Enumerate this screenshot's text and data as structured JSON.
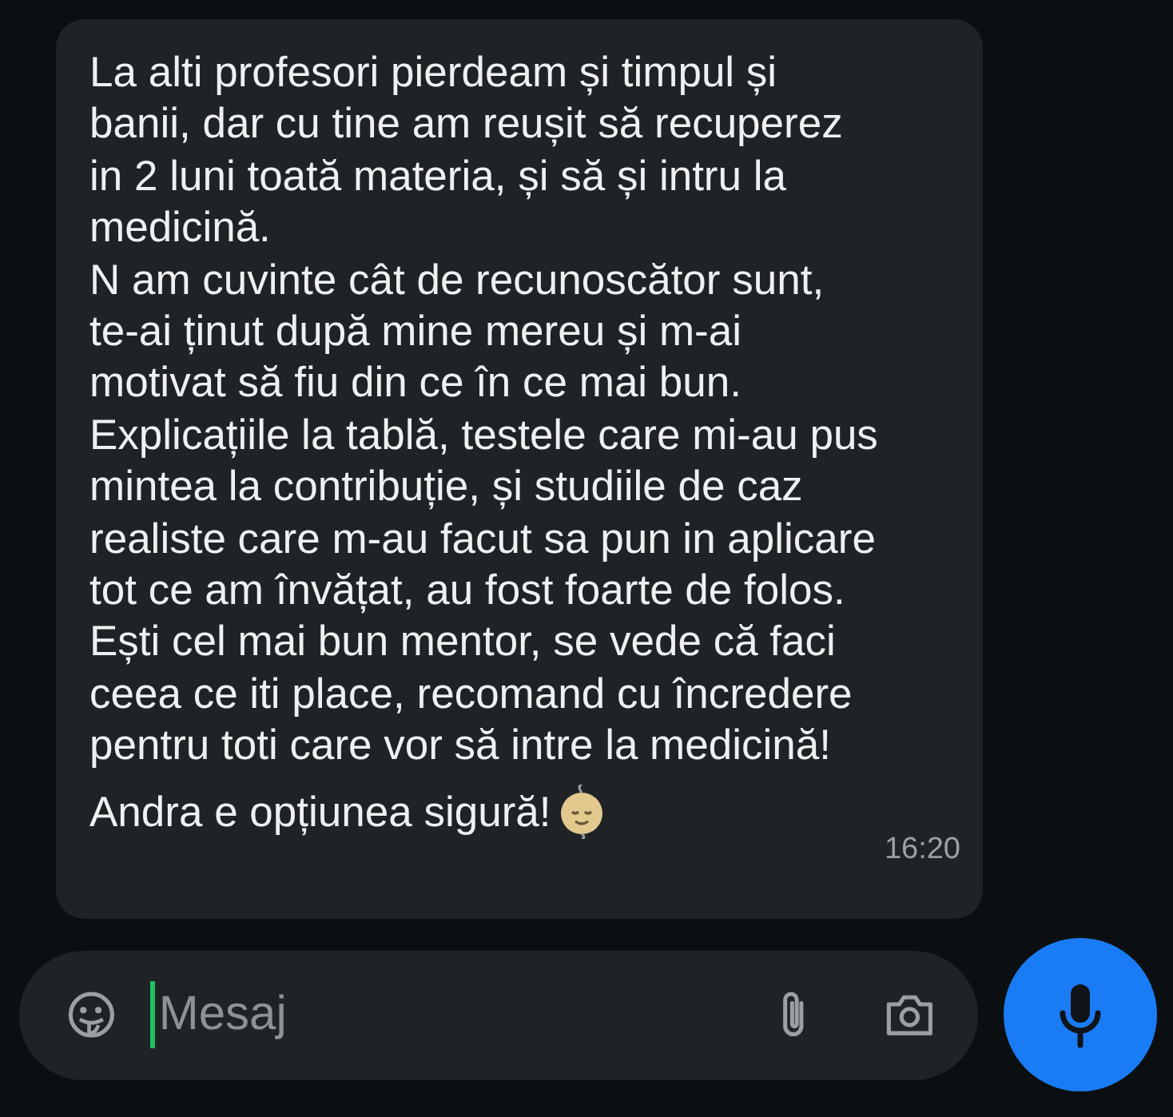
{
  "message": {
    "text": "La alti profesori pierdeam și timpul și\nbanii, dar cu tine am reușit să recuperez\nin 2 luni toată materia, și să și intru la\nmedicină.\nN am cuvinte cât de recunoscător sunt,\nte-ai ținut după mine mereu și m-ai\nmotivat să fiu din ce în ce mai bun.\nExplicațiile la tablă, testele care mi-au pus\nmintea la contribuție, și studiile de caz\nrealiste care m-au facut sa pun in aplicare\ntot ce am învățat, au fost foarte de folos.\nEști cel mai bun mentor, se vede că faci\nceea ce iti place, recomand cu încredere\npentru toti care vor să intre la medicină!",
    "last_line": "Andra e opțiunea sigură!",
    "time": "16:20"
  },
  "composer": {
    "placeholder": "Mesaj"
  }
}
